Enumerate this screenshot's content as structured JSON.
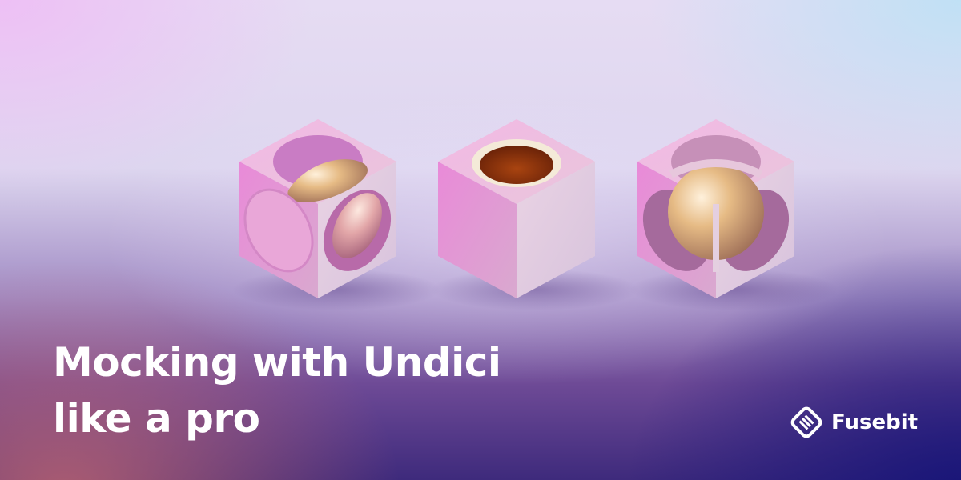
{
  "headline": {
    "line1": "Mocking with Undici",
    "line2": "like a pro"
  },
  "brand": {
    "name": "Fusebit",
    "icon": "fusebit-logo-icon"
  },
  "illustration": {
    "objects": [
      "cube-with-circular-cutouts-and-capsule",
      "cube-with-open-hole",
      "cube-with-circular-cutouts-and-sphere"
    ]
  },
  "colors": {
    "text": "#ffffff",
    "cube": "#ddb8d0",
    "gold": "#e2b47a",
    "hole": "#8a3008"
  }
}
